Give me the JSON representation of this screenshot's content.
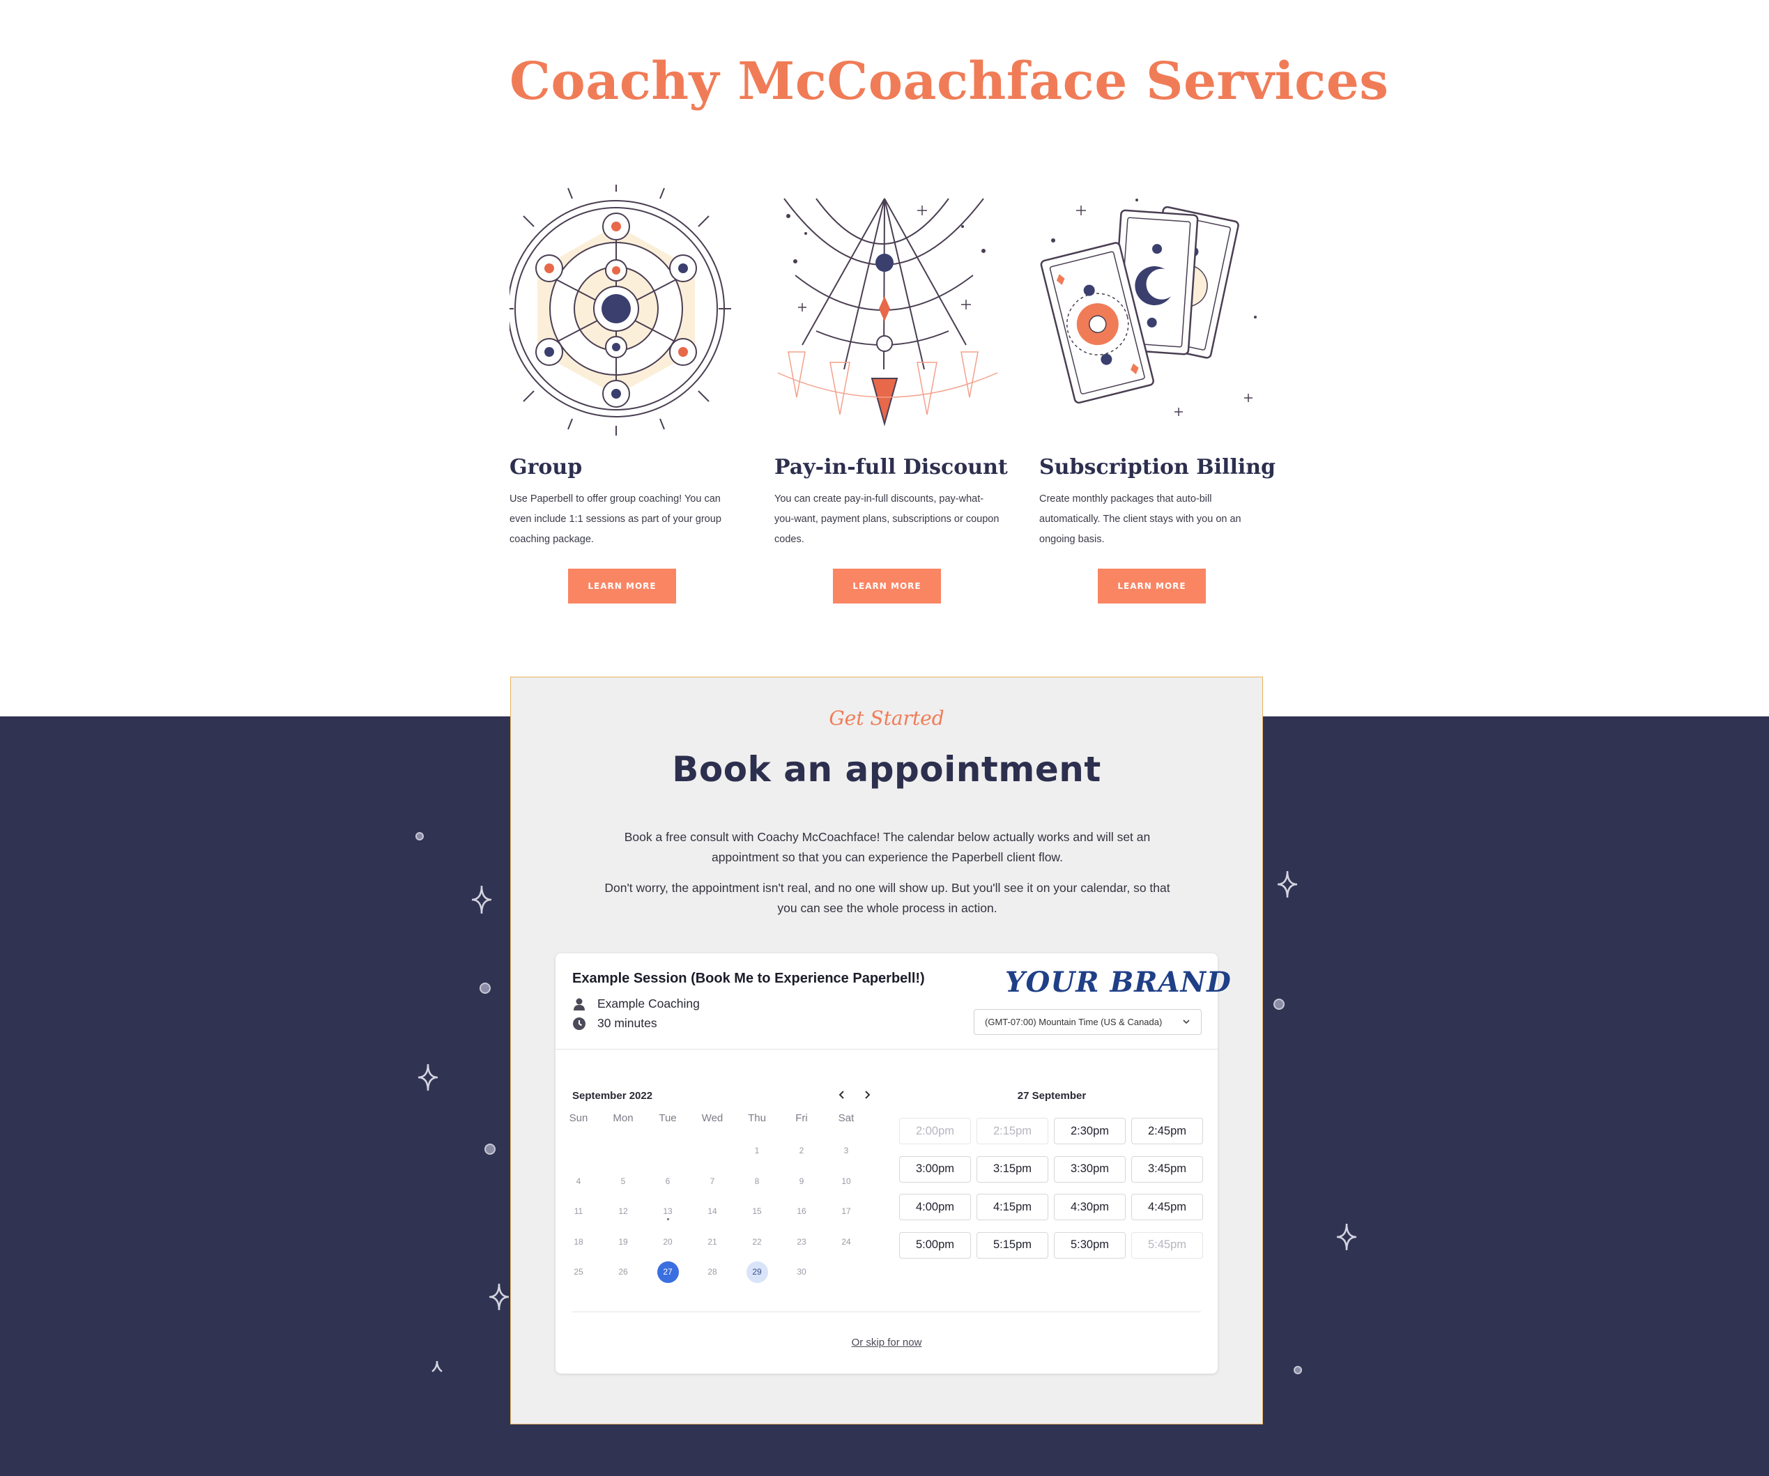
{
  "page": {
    "title": "Coachy McCoachface Services"
  },
  "services": [
    {
      "title": "Group",
      "description": "Use Paperbell to offer group coaching! You can even include 1:1 sessions as part of your group coaching package.",
      "button": "LEARN MORE",
      "illustration": "zodiac-wheel-illustration"
    },
    {
      "title": "Pay-in-full Discount",
      "description": "You can create  pay-in-full discounts, pay-what-you-want, payment plans, subscriptions or coupon codes.",
      "button": "LEARN MORE",
      "illustration": "hanging-crystals-illustration"
    },
    {
      "title": "Subscription Billing",
      "description": "Create monthly packages that auto-bill automatically. The client stays with you on an ongoing basis.",
      "button": "LEARN MORE",
      "illustration": "tarot-cards-illustration"
    }
  ],
  "booking": {
    "eyebrow": "Get Started",
    "title": "Book an appointment",
    "intro_1": "Book a free consult with Coachy McCoachface! The calendar below actually works and will set an appointment so that you can experience the Paperbell client flow.",
    "intro_2": "Don't worry, the appointment isn't real, and no one will show up. But you'll see it on your calendar, so that you can see the whole process in action."
  },
  "widget": {
    "session_title": "Example Session (Book Me to Experience Paperbell!)",
    "coach": "Example Coaching",
    "duration": "30 minutes",
    "coach_icon": "person-icon",
    "duration_icon": "clock-icon",
    "brand": "YOUR BRAND",
    "timezone": "(GMT-07:00) Mountain Time (US & Canada)",
    "month": "September 2022",
    "weekdays": [
      "Sun",
      "Mon",
      "Tue",
      "Wed",
      "Thu",
      "Fri",
      "Sat"
    ],
    "weeks": [
      [
        "",
        "",
        "",
        "",
        "1",
        "2",
        "3"
      ],
      [
        "4",
        "5",
        "6",
        "7",
        "8",
        "9",
        "10"
      ],
      [
        "11",
        "12",
        "13",
        "14",
        "15",
        "16",
        "17"
      ],
      [
        "18",
        "19",
        "20",
        "21",
        "22",
        "23",
        "24"
      ],
      [
        "25",
        "26",
        "27",
        "28",
        "29",
        "30",
        ""
      ]
    ],
    "today": "13",
    "selected_day": "27",
    "available_days": [
      "29"
    ],
    "selected_date_label": "27 September",
    "slots": [
      {
        "time": "2:00pm",
        "available": false
      },
      {
        "time": "2:15pm",
        "available": false
      },
      {
        "time": "2:30pm",
        "available": true
      },
      {
        "time": "2:45pm",
        "available": true
      },
      {
        "time": "3:00pm",
        "available": true
      },
      {
        "time": "3:15pm",
        "available": true
      },
      {
        "time": "3:30pm",
        "available": true
      },
      {
        "time": "3:45pm",
        "available": true
      },
      {
        "time": "4:00pm",
        "available": true
      },
      {
        "time": "4:15pm",
        "available": true
      },
      {
        "time": "4:30pm",
        "available": true
      },
      {
        "time": "4:45pm",
        "available": true
      },
      {
        "time": "5:00pm",
        "available": true
      },
      {
        "time": "5:15pm",
        "available": true
      },
      {
        "time": "5:30pm",
        "available": true
      },
      {
        "time": "5:45pm",
        "available": false
      }
    ],
    "skip_link": "Or skip for now"
  },
  "colors": {
    "accent": "#f07c57",
    "button": "#f98563",
    "navy": "#313352",
    "card_border": "#e6b25e",
    "selected_day": "#3b6fe0",
    "available_day": "#d9e4f9",
    "brand": "#1f3f87"
  }
}
